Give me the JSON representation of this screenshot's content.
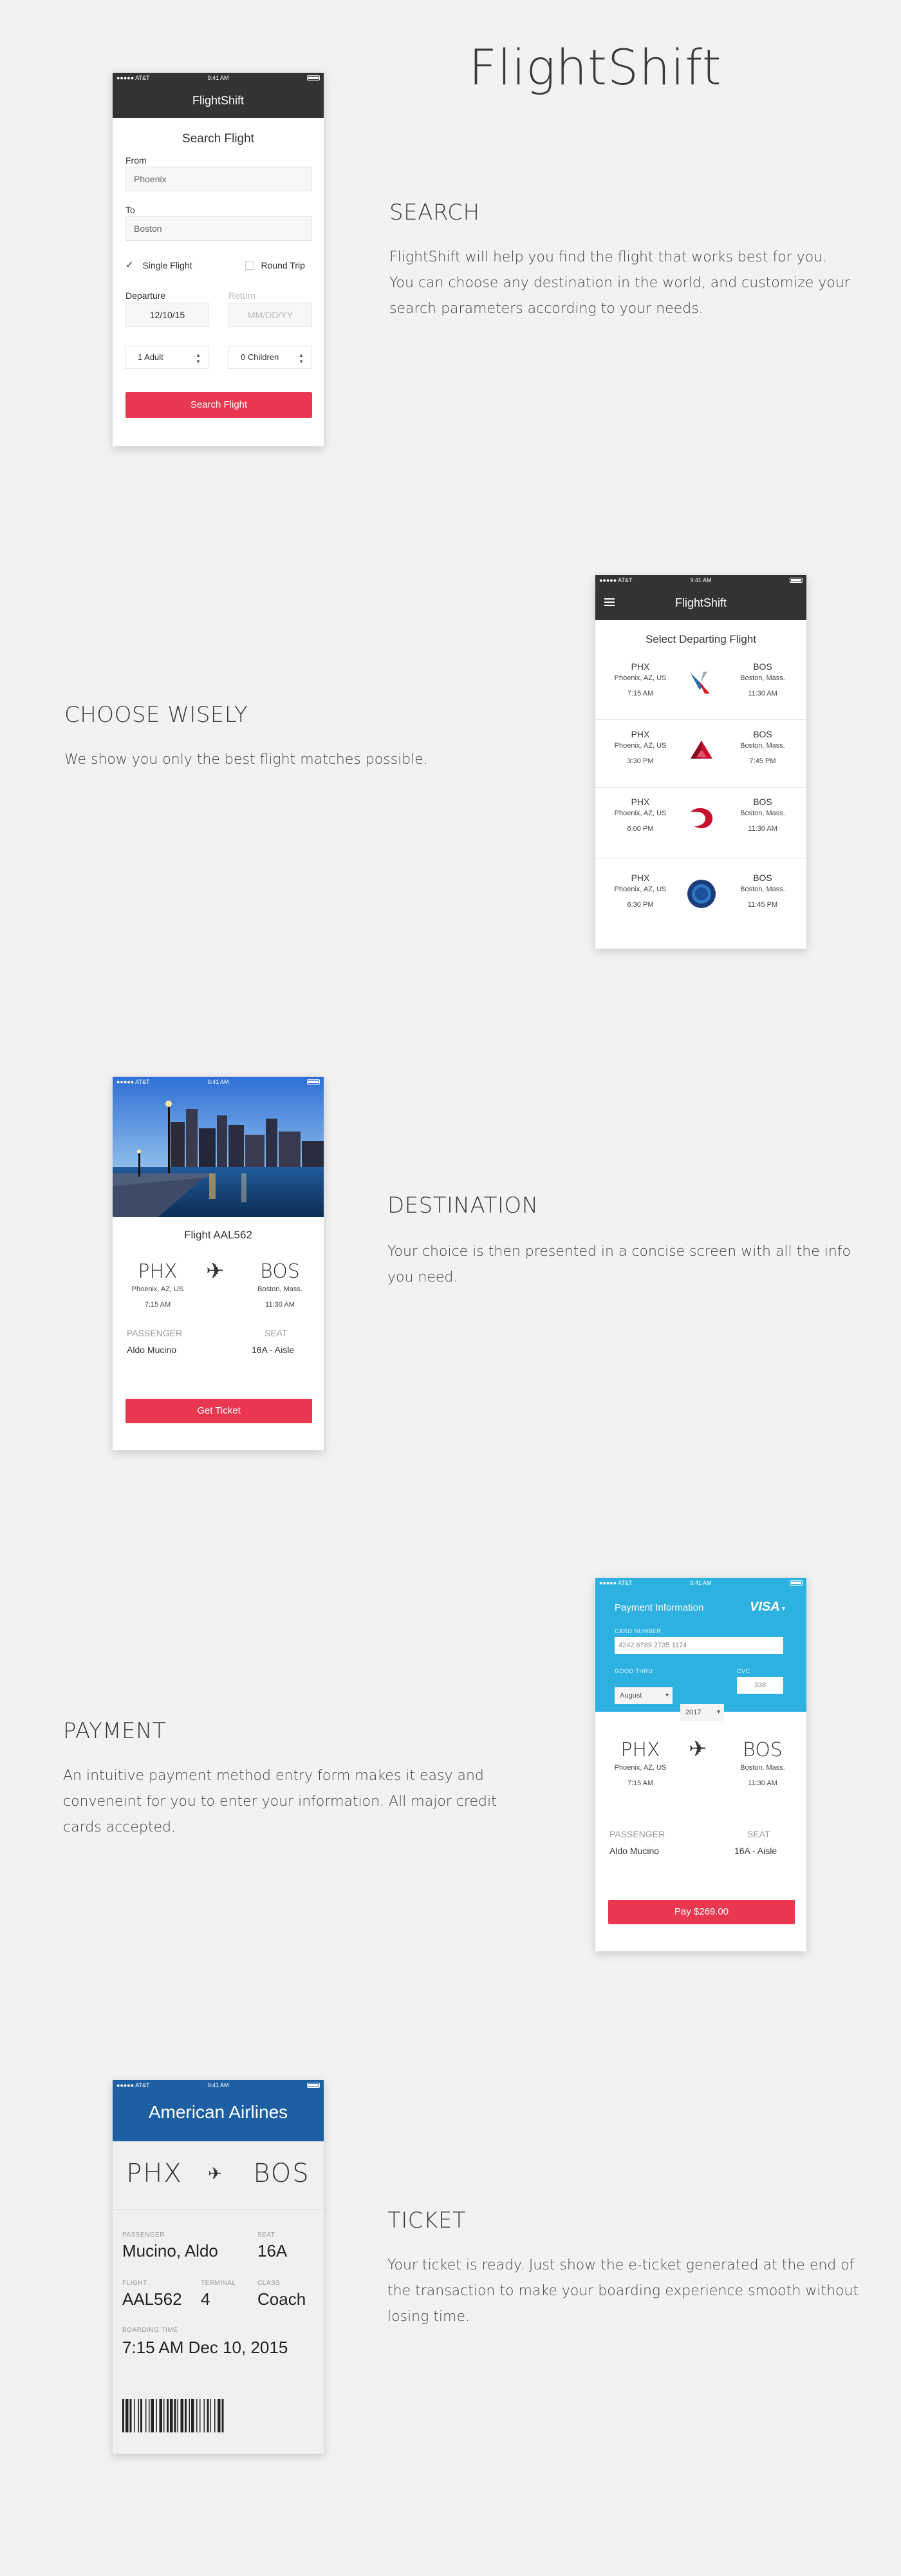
{
  "app": {
    "title": "FlightShift"
  },
  "status_bar": {
    "carrier": "●●●●● AT&T",
    "time": "9:41 AM"
  },
  "sections": {
    "search": {
      "heading": "SEARCH",
      "body": [
        "FlightShift will help you find the flight that works best for you.",
        "You can choose any destination in the world, and customize your",
        "search parameters according to your needs."
      ]
    },
    "choose": {
      "heading": "CHOOSE WISELY",
      "body": [
        "We show you only the best flight matches possible."
      ]
    },
    "destination": {
      "heading": "DESTINATION",
      "body": [
        "Your choice is then presented in a concise screen with all the info",
        "you need."
      ]
    },
    "payment": {
      "heading": "PAYMENT",
      "body": [
        "An intuitive payment method entry form makes it easy and",
        "conveneint for you to enter your information. All major credit",
        "cards accepted."
      ]
    },
    "ticket": {
      "heading": "TICKET",
      "body": [
        "Your ticket is ready. Just show the e-ticket generated at the end of",
        "the transaction to make your boarding experience smooth without",
        "losing time."
      ]
    }
  },
  "search_screen": {
    "nav_title": "FlightShift",
    "title": "Search Flight",
    "from_label": "From",
    "from_value": "Phoenix",
    "to_label": "To",
    "to_value": "Boston",
    "single_flight": "Single Flight",
    "round_trip": "Round Trip",
    "departure_label": "Departure",
    "departure_value": "12/10/15",
    "return_label": "Return",
    "return_placeholder": "MM/DD/YY",
    "adults": "1 Adult",
    "children": "0 Children",
    "button": "Search Flight"
  },
  "list_screen": {
    "nav_title": "FlightShift",
    "title": "Select Departing Flight",
    "flights": [
      {
        "from_code": "PHX",
        "from_city": "Phoenix, AZ, US",
        "dep_time": "7:15 AM",
        "to_code": "BOS",
        "to_city": "Boston, Mass.",
        "arr_time": "11:30 AM",
        "airline_icon": "american-airlines-logo"
      },
      {
        "from_code": "PHX",
        "from_city": "Phoenix, AZ, US",
        "dep_time": "3:30 PM",
        "to_code": "BOS",
        "to_city": "Boston, Mass.",
        "arr_time": "7:45 PM",
        "airline_icon": "delta-logo"
      },
      {
        "from_code": "PHX",
        "from_city": "Phoenix, AZ, US",
        "dep_time": "6:00 PM",
        "to_code": "BOS",
        "to_city": "Boston, Mass.",
        "arr_time": "11:30 AM",
        "airline_icon": "virgin-logo"
      },
      {
        "from_code": "PHX",
        "from_city": "Phoenix, AZ, US",
        "dep_time": "6:30 PM",
        "to_code": "BOS",
        "to_city": "Boston, Mass.",
        "arr_time": "11:45 PM",
        "airline_icon": "united-logo"
      }
    ]
  },
  "destination_screen": {
    "flight": "Flight AAL562",
    "from_code": "PHX",
    "from_city": "Phoenix, AZ, US",
    "dep_time": "7:15 AM",
    "to_code": "BOS",
    "to_city": "Boston, Mass.",
    "arr_time": "11:30 AM",
    "passenger_label": "PASSENGER",
    "passenger": "Aldo Mucino",
    "seat_label": "SEAT",
    "seat": "16A - Aisle",
    "button": "Get Ticket"
  },
  "payment_screen": {
    "title": "Payment Information",
    "card_brand": "VISA",
    "card_number_label": "CARD NUMBER",
    "card_number": "4242 6789 2735 1174",
    "good_thru_label": "GOOD THRU",
    "month": "August",
    "year": "2017",
    "cvc_label": "CVC",
    "cvc": "338",
    "from_code": "PHX",
    "from_city": "Phoenix, AZ, US",
    "dep_time": "7:15 AM",
    "to_code": "BOS",
    "to_city": "Boston, Mass.",
    "arr_time": "11:30 AM",
    "passenger_label": "PASSENGER",
    "passenger": "Aldo Mucino",
    "seat_label": "SEAT",
    "seat": "16A - Aisle",
    "button": "Pay $269.00"
  },
  "ticket_screen": {
    "airline": "American Airlines",
    "from_code": "PHX",
    "to_code": "BOS",
    "passenger_label": "PASSENGER",
    "passenger": "Mucino, Aldo",
    "seat_label": "SEAT",
    "seat": "16A",
    "flight_label": "FLIGHT",
    "flight": "AAL562",
    "terminal_label": "TERMINAL",
    "terminal": "4",
    "class_label": "CLASS",
    "class": "Coach",
    "boarding_label": "BOARDING TIME",
    "boarding": "7:15 AM Dec 10, 2015"
  },
  "colors": {
    "accent_red": "#e8374f",
    "nav_dark": "#333333",
    "payment_blue": "#2cb1e1",
    "ticket_blue": "#1e5fa3",
    "background": "#f2f2f2"
  }
}
